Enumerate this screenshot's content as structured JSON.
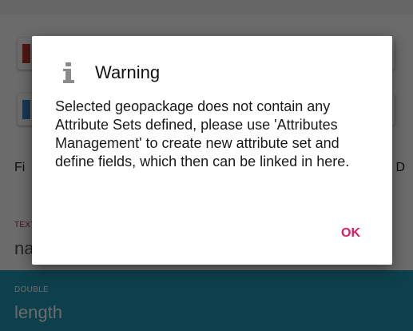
{
  "background": {
    "fields_label": "Fi",
    "fields_right": "D",
    "text_field": {
      "type": "TEXT",
      "name": "na"
    },
    "double_field": {
      "type": "DOUBLE",
      "name": "length"
    }
  },
  "dialog": {
    "icon": "info-icon",
    "title": "Warning",
    "message": "Selected geopackage does not contain any Attribute Sets defined, please use 'Attributes Management' to create new attribute set and define fields, which then can be linked in here.",
    "ok_label": "OK"
  },
  "colors": {
    "accent": "#d81b60",
    "selected_row": "#2098b6",
    "scrim": "rgba(0,0,0,0.58)"
  }
}
